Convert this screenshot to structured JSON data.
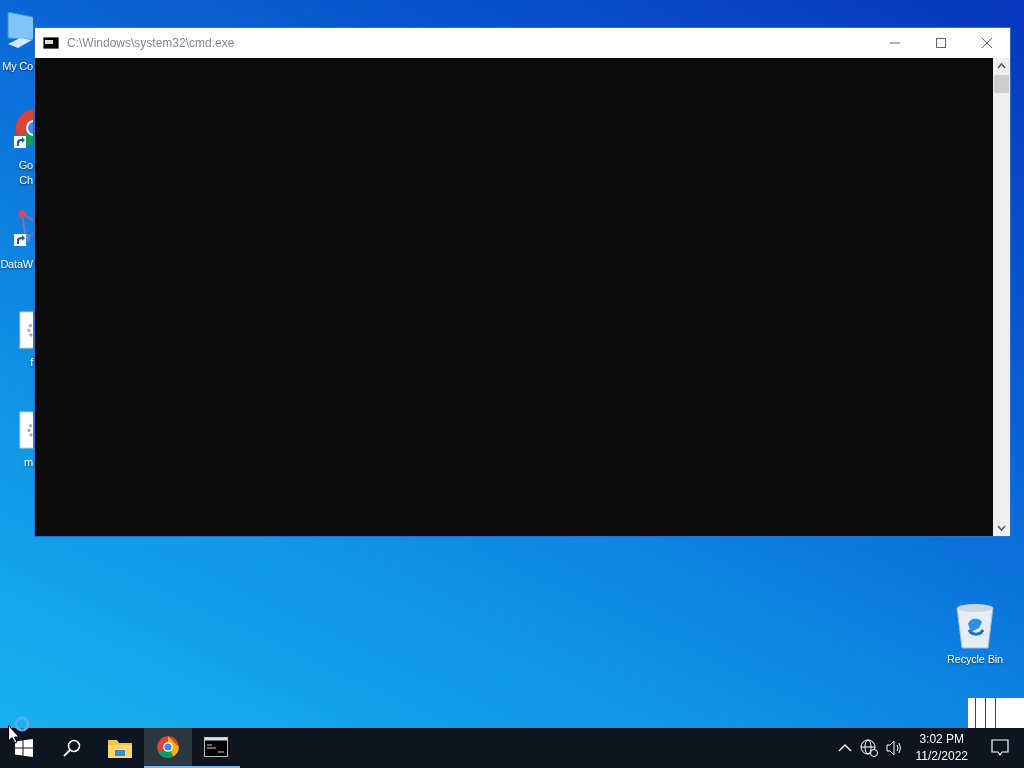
{
  "desktop_icons": [
    {
      "kind": "computer",
      "lines": [
        "My Co"
      ],
      "shortcut": false
    },
    {
      "kind": "chrome",
      "lines": [
        "Go",
        "Ch"
      ],
      "shortcut": true
    },
    {
      "kind": "network",
      "lines": [
        "DataW"
      ],
      "shortcut": true
    },
    {
      "kind": "file",
      "lines": [
        "f"
      ],
      "shortcut": false
    },
    {
      "kind": "file",
      "lines": [
        "m"
      ],
      "shortcut": false
    },
    {
      "kind": "recycle",
      "lines": [
        "Recycle Bin"
      ],
      "shortcut": false
    }
  ],
  "window": {
    "title": "C:\\Windows\\system32\\cmd.exe"
  },
  "taskbar": {
    "items": [
      {
        "kind": "start",
        "running": false,
        "selected": false
      },
      {
        "kind": "search",
        "running": false,
        "selected": false
      },
      {
        "kind": "explorer",
        "running": false,
        "selected": false
      },
      {
        "kind": "chrome",
        "running": true,
        "selected": true
      },
      {
        "kind": "cmd",
        "running": true,
        "selected": false
      }
    ],
    "tray": {
      "time": "3:02 PM",
      "date": "11/2/2022"
    }
  }
}
